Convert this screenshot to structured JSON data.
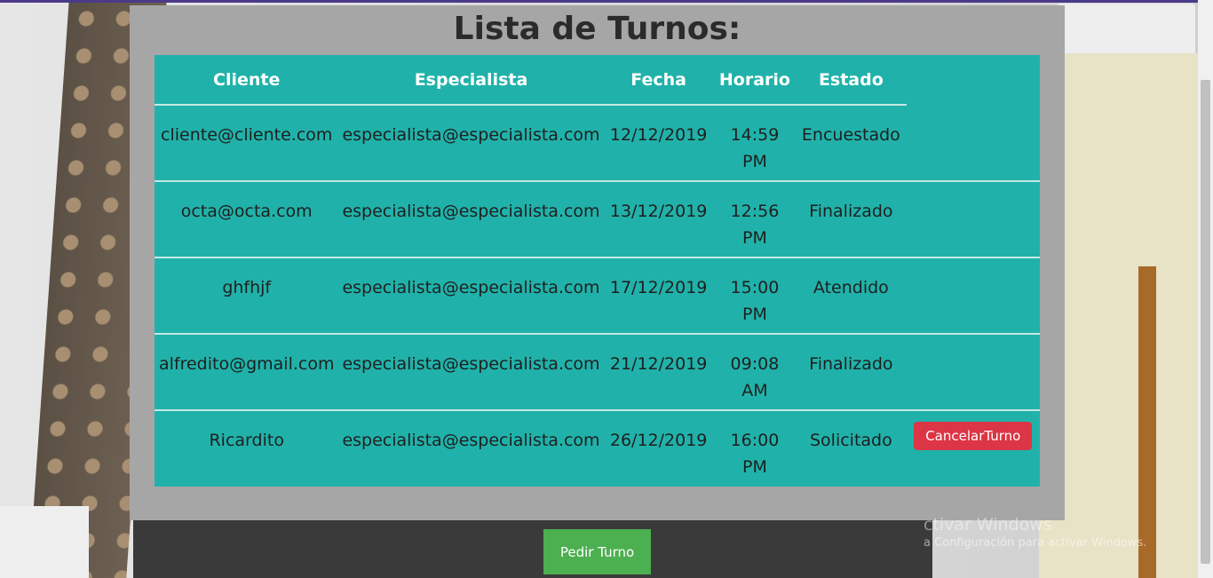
{
  "page": {
    "title": "Lista de Turnos:",
    "columns": [
      "Cliente",
      "Especialista",
      "Fecha",
      "Horario",
      "Estado",
      ""
    ],
    "rows": [
      {
        "cliente": "cliente@cliente.com",
        "especialista": "especialista@especialista.com",
        "fecha": "12/12/2019",
        "horario_h": "14:59",
        "horario_p": "PM",
        "estado": "Encuestado",
        "action": ""
      },
      {
        "cliente": "octa@octa.com",
        "especialista": "especialista@especialista.com",
        "fecha": "13/12/2019",
        "horario_h": "12:56",
        "horario_p": "PM",
        "estado": "Finalizado",
        "action": ""
      },
      {
        "cliente": "ghfhjf",
        "especialista": "especialista@especialista.com",
        "fecha": "17/12/2019",
        "horario_h": "15:00",
        "horario_p": "PM",
        "estado": "Atendido",
        "action": ""
      },
      {
        "cliente": "alfredito@gmail.com",
        "especialista": "especialista@especialista.com",
        "fecha": "21/12/2019",
        "horario_h": "09:08",
        "horario_p": "AM",
        "estado": "Finalizado",
        "action": ""
      },
      {
        "cliente": "Ricardito",
        "especialista": "especialista@especialista.com",
        "fecha": "26/12/2019",
        "horario_h": "16:00",
        "horario_p": "PM",
        "estado": "Solicitado",
        "action": "CancelarTurno"
      }
    ],
    "pedir_label": "Pedir Turno"
  },
  "watermark": {
    "line1": "ctivar Windows",
    "line2": "a Configuración para activar Windows."
  },
  "colors": {
    "table_bg": "#20b2aa",
    "panel_bg": "#a6a6a6",
    "cancel_bg": "#dc3545",
    "pedir_bg": "#4caf50"
  }
}
